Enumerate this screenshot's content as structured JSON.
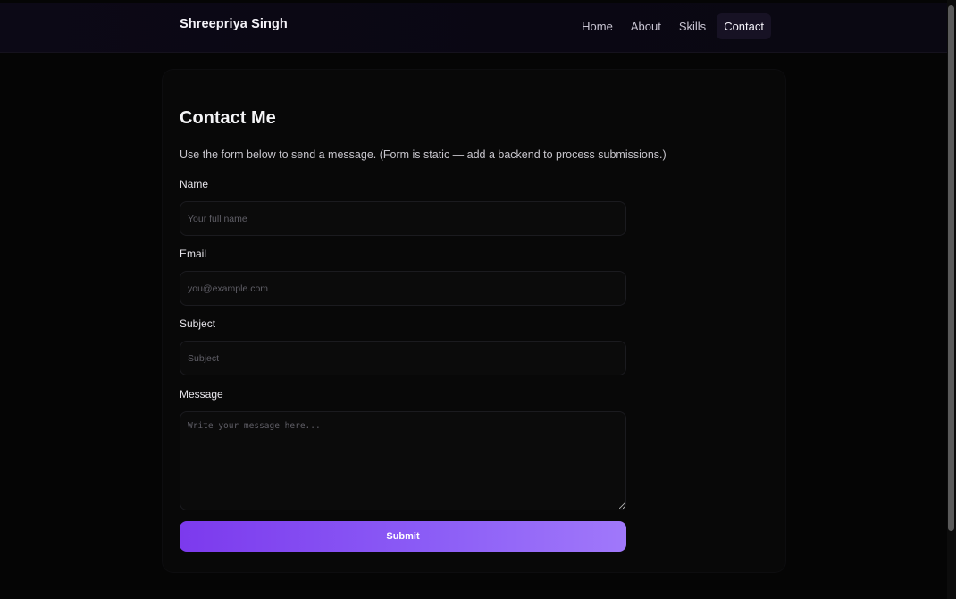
{
  "navbar": {
    "brand": "Shreepriya Singh",
    "links": [
      {
        "label": "Home",
        "active": false
      },
      {
        "label": "About",
        "active": false
      },
      {
        "label": "Skills",
        "active": false
      },
      {
        "label": "Contact",
        "active": true
      }
    ]
  },
  "contact": {
    "title": "Contact Me",
    "intro": "Use the form below to send a message. (Form is static — add a backend to process submissions.)",
    "fields": {
      "name": {
        "label": "Name",
        "placeholder": "Your full name",
        "value": ""
      },
      "email": {
        "label": "Email",
        "placeholder": "you@example.com",
        "value": ""
      },
      "subject": {
        "label": "Subject",
        "placeholder": "Subject",
        "value": ""
      },
      "message": {
        "label": "Message",
        "placeholder": "Write your message here...",
        "value": ""
      }
    },
    "submit_label": "Submit"
  },
  "colors": {
    "accent": "#8b5cf6",
    "background": "#050505",
    "card": "#080808"
  }
}
